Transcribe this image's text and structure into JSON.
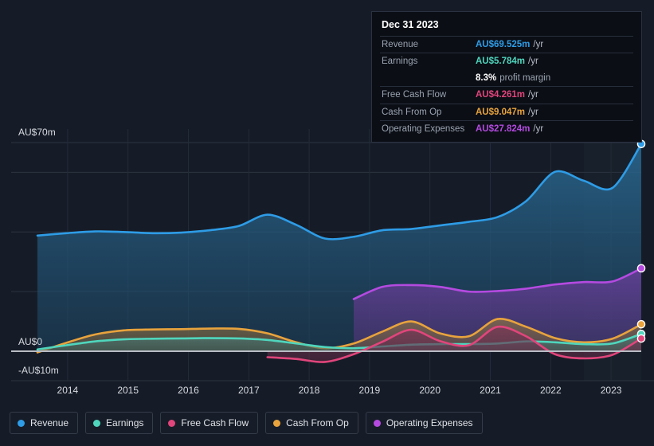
{
  "background": "#161c27",
  "tooltip": {
    "date": "Dec 31 2023",
    "rows": [
      {
        "label": "Revenue",
        "value": "AU$69.525m",
        "unit": "/yr",
        "color": "#2e9ce6"
      },
      {
        "label": "Earnings",
        "value": "AU$5.784m",
        "unit": "/yr",
        "color": "#4fd6bd"
      },
      {
        "label": "",
        "value": "8.3%",
        "unit": "profit margin",
        "color": "#ffffff",
        "sub": true
      },
      {
        "label": "Free Cash Flow",
        "value": "AU$4.261m",
        "unit": "/yr",
        "color": "#e0457b"
      },
      {
        "label": "Cash From Op",
        "value": "AU$9.047m",
        "unit": "/yr",
        "color": "#e8a33d"
      },
      {
        "label": "Operating Expenses",
        "value": "AU$27.824m",
        "unit": "/yr",
        "color": "#b44ae0"
      }
    ]
  },
  "legend": {
    "items": [
      {
        "label": "Revenue",
        "color": "#2e9ce6"
      },
      {
        "label": "Earnings",
        "color": "#4fd6bd"
      },
      {
        "label": "Free Cash Flow",
        "color": "#e0457b"
      },
      {
        "label": "Cash From Op",
        "color": "#e8a33d"
      },
      {
        "label": "Operating Expenses",
        "color": "#b44ae0"
      }
    ]
  },
  "axes": {
    "y_labels": [
      {
        "text": "AU$70m",
        "value": 70
      },
      {
        "text": "AU$0",
        "value": 0
      },
      {
        "text": "-AU$10m",
        "value": -10
      }
    ],
    "x_labels": [
      "2014",
      "2015",
      "2016",
      "2017",
      "2018",
      "2019",
      "2020",
      "2021",
      "2022",
      "2023"
    ]
  },
  "chart_data": {
    "type": "area",
    "title": "",
    "xlabel": "",
    "ylabel": "AU$ millions",
    "ylim": [
      -10,
      75
    ],
    "yticks": [
      -10,
      0,
      70
    ],
    "gridlines": [
      70,
      60,
      40,
      20,
      0
    ],
    "grid": true,
    "legend_position": "bottom",
    "currency": "AU$",
    "units": "millions per year",
    "x": [
      "2013.5",
      "2014",
      "2014.5",
      "2015",
      "2015.5",
      "2016",
      "2016.5",
      "2017",
      "2017.5",
      "2018",
      "2018.5",
      "2019",
      "2019.5",
      "2020",
      "2020.5",
      "2021",
      "2021.5",
      "2022",
      "2022.5",
      "2023",
      "2023.5",
      "2023.99"
    ],
    "series": [
      {
        "name": "Revenue",
        "color": "#2e9ce6",
        "fill": "#1b4663",
        "values": [
          38.8,
          39.6,
          40.2,
          40.0,
          39.6,
          39.8,
          40.6,
          42.0,
          45.8,
          42.4,
          37.8,
          38.4,
          40.6,
          41.0,
          42.2,
          43.4,
          45.0,
          50.4,
          60.2,
          57.2,
          54.8,
          69.5
        ]
      },
      {
        "name": "Operating Expenses",
        "color": "#b44ae0",
        "fill": "#40305f",
        "values": [
          null,
          null,
          null,
          null,
          null,
          null,
          null,
          null,
          null,
          null,
          null,
          17.5,
          21.6,
          22.2,
          21.6,
          20.0,
          20.2,
          21.0,
          22.4,
          23.2,
          23.4,
          27.8
        ]
      },
      {
        "name": "Cash From Op",
        "color": "#e8a33d",
        "fill": "#5d4a33",
        "values": [
          -0.4,
          2.8,
          5.6,
          7.0,
          7.3,
          7.4,
          7.6,
          7.5,
          6.0,
          3.0,
          1.0,
          2.6,
          6.6,
          10.0,
          6.0,
          5.0,
          10.8,
          8.2,
          4.4,
          3.0,
          4.2,
          9.0
        ]
      },
      {
        "name": "Earnings",
        "color": "#4fd6bd",
        "fill": "#3c5f5e",
        "values": [
          0.6,
          2.0,
          3.3,
          4.0,
          4.2,
          4.3,
          4.4,
          4.3,
          3.8,
          2.6,
          1.4,
          1.0,
          1.6,
          2.2,
          2.4,
          2.4,
          2.6,
          3.3,
          3.0,
          2.4,
          2.6,
          5.8
        ]
      },
      {
        "name": "Free Cash Flow",
        "color": "#e0457b",
        "fill": "#5a2a44",
        "values": [
          null,
          null,
          null,
          null,
          null,
          null,
          null,
          null,
          -2.0,
          -2.6,
          -3.6,
          -1.0,
          3.2,
          7.2,
          3.4,
          2.0,
          8.2,
          5.0,
          -1.0,
          -2.4,
          -1.2,
          4.3
        ]
      }
    ],
    "endpoint_markers": [
      {
        "series": "Revenue",
        "value": 69.525,
        "color": "#2e9ce6"
      },
      {
        "series": "Operating Expenses",
        "value": 27.824,
        "color": "#b44ae0"
      },
      {
        "series": "Cash From Op",
        "value": 9.047,
        "color": "#e8a33d"
      },
      {
        "series": "Earnings",
        "value": 5.784,
        "color": "#4fd6bd"
      },
      {
        "series": "Free Cash Flow",
        "value": 4.261,
        "color": "#e0457b"
      }
    ]
  }
}
